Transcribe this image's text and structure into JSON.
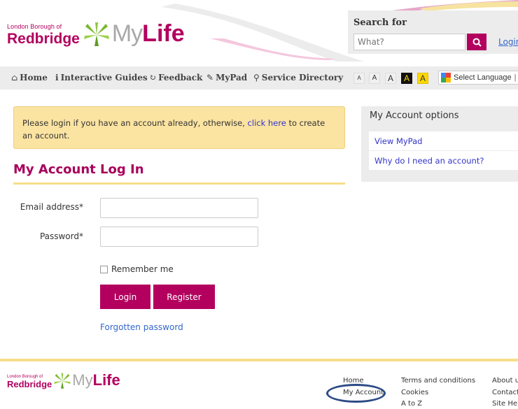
{
  "header": {
    "logo_small": "London Borough of",
    "logo_big": "Redbridge",
    "logo_my": "My",
    "logo_life": "Life",
    "search_label": "Search for",
    "search_placeholder": "What?",
    "search_icon": "search-icon",
    "login_link": "Login"
  },
  "nav": {
    "items": [
      {
        "icon": "home-icon",
        "label": "Home"
      },
      {
        "icon": "info-icon",
        "label": "Interactive Guides"
      },
      {
        "icon": "refresh-icon",
        "label": "Feedback"
      },
      {
        "icon": "edit-icon",
        "label": "MyPad"
      },
      {
        "icon": "map-marker-icon",
        "label": "Service Directory"
      }
    ],
    "font_sizes": [
      "A",
      "A",
      "A",
      "A",
      "A"
    ],
    "language": "Select Language"
  },
  "alert": {
    "text_before": "Please login if you have an account already, otherwise, ",
    "link": "click here",
    "text_after": " to create an account."
  },
  "page": {
    "title": "My Account Log In"
  },
  "form": {
    "email_label": "Email address*",
    "password_label": "Password*",
    "remember_label": "Remember me",
    "login_button": "Login",
    "register_button": "Register",
    "forgot_link": "Forgotten password"
  },
  "sidebar": {
    "heading": "My Account options",
    "items": [
      "View MyPad",
      "Why do I need an account?"
    ]
  },
  "footer": {
    "col1": [
      "Home",
      "My Account"
    ],
    "col2": [
      "Terms and conditions",
      "Cookies",
      "A to Z"
    ],
    "col3": [
      "About us",
      "Contact",
      "Site Help"
    ]
  },
  "colors": {
    "brand": "#b3005e",
    "accent_bar": "#f7de8a",
    "alert_bg": "#fbe3a1",
    "panel_bg": "#ececec",
    "link": "#3366cc"
  }
}
